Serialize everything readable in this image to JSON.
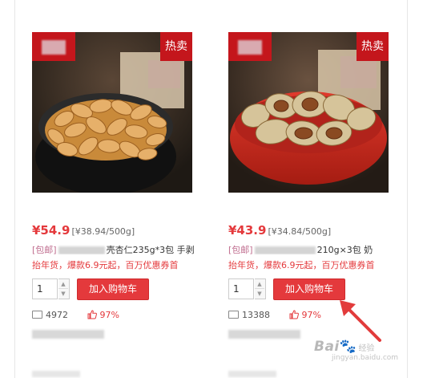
{
  "products": [
    {
      "badge": "热卖",
      "price": "¥54.9",
      "unit_price": "[¥38.94/500g]",
      "tag": "[包邮]",
      "title_suffix": "壳杏仁235g*3包 手剥",
      "promo": "抬年货，爆款6.9元起，百万优惠券首",
      "quantity": "1",
      "add_cart_label": "加入购物车",
      "comments": "4972",
      "rating": "97%",
      "image": "almonds-in-black-bowl"
    },
    {
      "badge": "热卖",
      "price": "¥43.9",
      "unit_price": "[¥34.84/500g]",
      "tag": "[包邮]",
      "title_suffix": "210g×3包 奶",
      "promo": "抬年货，爆款6.9元起，百万优惠券首",
      "quantity": "1",
      "add_cart_label": "加入购物车",
      "comments": "13388",
      "rating": "97%",
      "image": "pecans-in-red-bowl"
    }
  ],
  "icons": {
    "comment": "comment-icon",
    "like": "thumbs-up-icon",
    "stepper_up": "caret-up-icon",
    "stepper_down": "caret-down-icon"
  },
  "colors": {
    "price_red": "#e4393c",
    "badge_red": "#c4161c",
    "tag_pink": "#c06e8f",
    "arrow_red": "#e23b3b"
  },
  "watermark": {
    "brand": "Bai",
    "brand_tail": "经验",
    "url": "jingyan.baidu.com"
  }
}
